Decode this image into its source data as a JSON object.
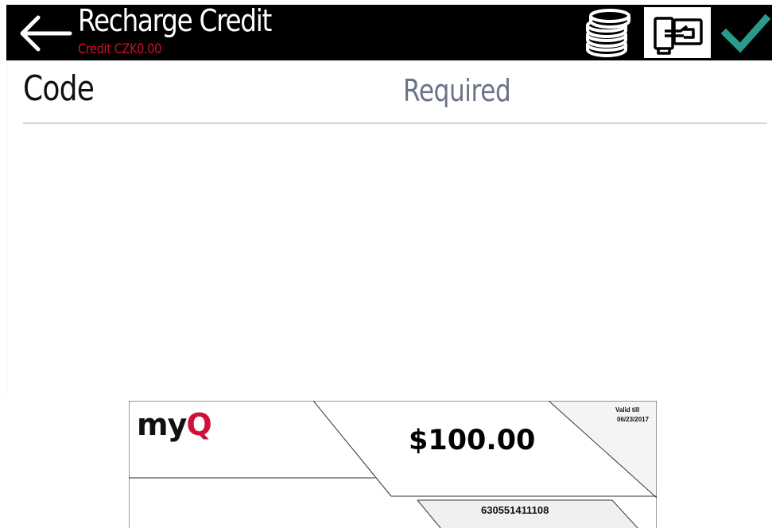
{
  "header": {
    "title": "Recharge Credit",
    "credit_text": "Credit CZK0.00",
    "back_icon": "arrow-left-icon",
    "coins_icon": "coins-stack-icon",
    "card_icon": "card-voucher-icon",
    "confirm_icon": "checkmark-icon",
    "confirm_color": "#2a9b8a",
    "credit_color": "#c8102e"
  },
  "form": {
    "code_label": "Code",
    "code_placeholder": "Required"
  },
  "voucher": {
    "brand_prefix": "my",
    "brand_accent": "Q",
    "amount": "$100.00",
    "valid_label": "Valid till",
    "valid_date": "06/23/2017",
    "code": "630551411108",
    "brand_color": "#d0103a"
  }
}
